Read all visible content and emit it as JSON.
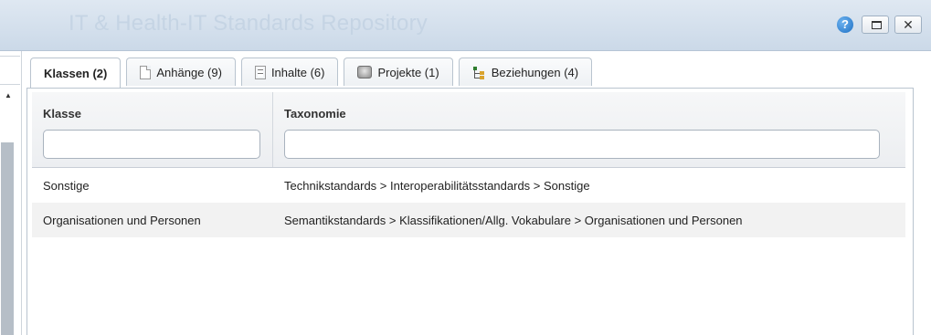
{
  "window": {
    "title": "IT & Health-IT Standards Repository"
  },
  "tabs": [
    {
      "label": "Klassen (2)",
      "icon": "none",
      "active": true
    },
    {
      "label": "Anhänge (9)",
      "icon": "document-icon",
      "active": false
    },
    {
      "label": "Inhalte (6)",
      "icon": "text-document-icon",
      "active": false
    },
    {
      "label": "Projekte (1)",
      "icon": "project-icon",
      "active": false
    },
    {
      "label": "Beziehungen (4)",
      "icon": "relations-tree-icon",
      "active": false
    }
  ],
  "grid": {
    "columns": [
      {
        "title": "Klasse",
        "filter_value": ""
      },
      {
        "title": "Taxonomie",
        "filter_value": ""
      }
    ],
    "rows": [
      {
        "klasse": "Sonstige",
        "taxonomie": "Technikstandards > Interoperabilitätsstandards > Sonstige"
      },
      {
        "klasse": "Organisationen und Personen",
        "taxonomie": "Semantikstandards > Klassifikationen/Allg. Vokabulare > Organisationen und Personen"
      }
    ]
  },
  "colors": {
    "titlebar": "#cbd9e8",
    "help_icon": "#1c6fc4",
    "row_alt": "#f2f2f2"
  }
}
